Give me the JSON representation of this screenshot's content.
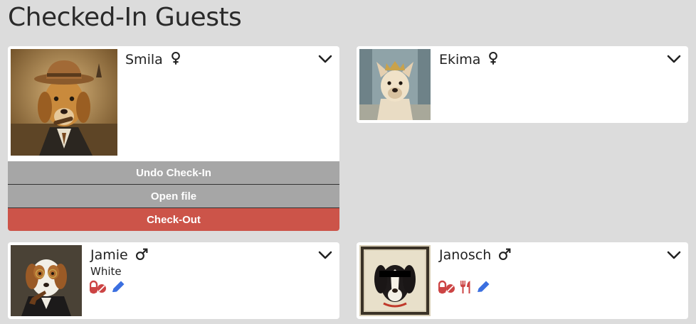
{
  "page": {
    "title": "Checked-In Guests"
  },
  "guests": [
    {
      "name": "Smila",
      "gender": "female",
      "expanded": true,
      "actions": {
        "undo": "Undo Check-In",
        "open": "Open file",
        "checkout": "Check-Out"
      }
    },
    {
      "name": "Ekima",
      "gender": "female",
      "expanded": false
    },
    {
      "name": "Jamie",
      "gender": "male",
      "color": "White",
      "icons": [
        "medication-icon",
        "edit-icon"
      ]
    },
    {
      "name": "Janosch",
      "gender": "male",
      "icons": [
        "medication-icon",
        "food-icon",
        "edit-icon"
      ]
    }
  ],
  "colors": {
    "background": "#dcdcdc",
    "card": "#ffffff",
    "action_grey": "#a6a6a6",
    "checkout_red": "#cc5449",
    "icon_red": "#cc4444",
    "icon_blue": "#3b6fe0"
  }
}
